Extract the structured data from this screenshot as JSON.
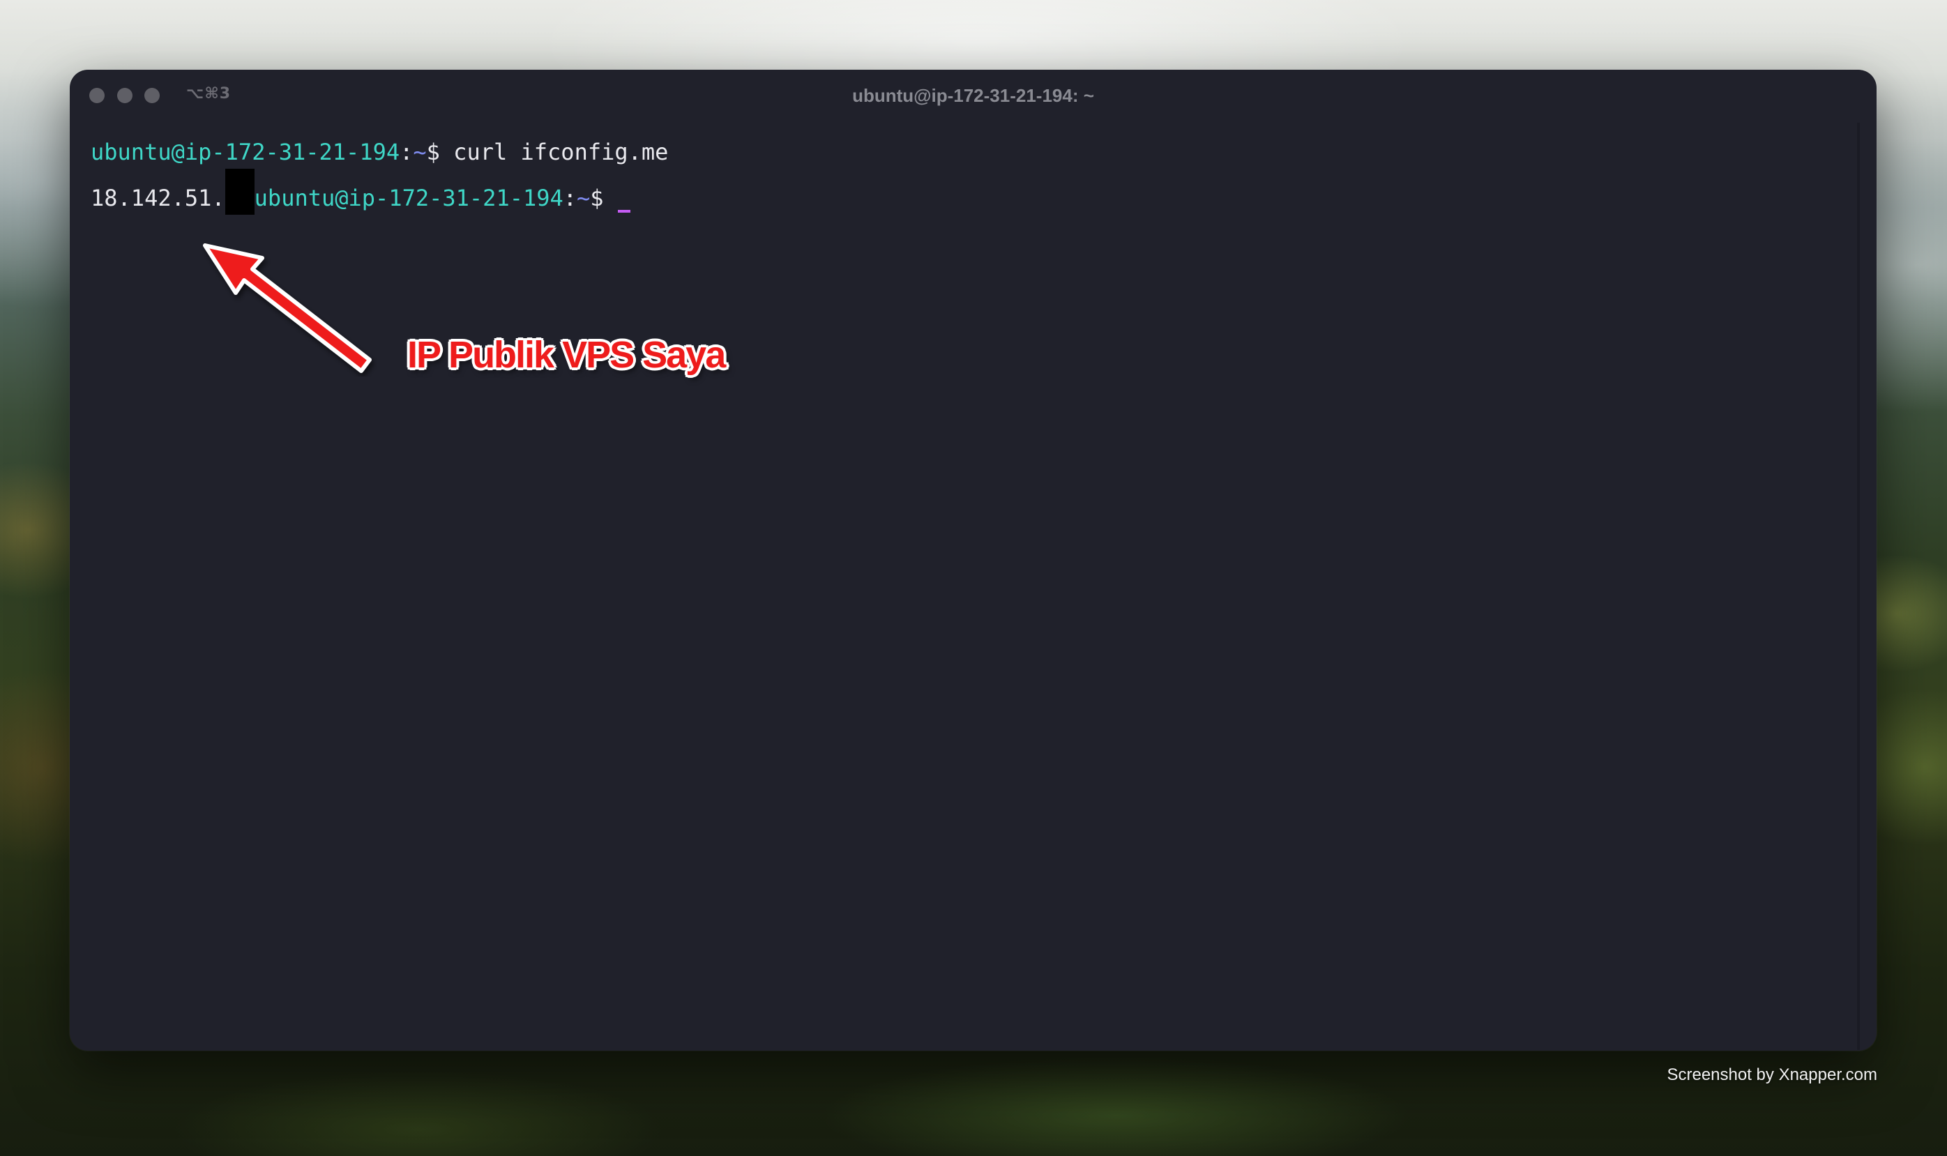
{
  "window": {
    "title": "ubuntu@ip-172-31-21-194: ~",
    "tab_shortcut": "⌥⌘3"
  },
  "terminal": {
    "lines": [
      {
        "user_host": "ubuntu@ip-172-31-21-194",
        "separator": ":",
        "path": "~",
        "dollar": "$",
        "command": " curl ifconfig.me"
      },
      {
        "output": "18.142.51.",
        "user_host": "ubuntu@ip-172-31-21-194",
        "separator": ":",
        "path": "~",
        "dollar": "$"
      }
    ],
    "colors": {
      "prompt_user": "#3fd7c7",
      "prompt_path": "#7f8cf0",
      "cursor": "#c45cf2",
      "background": "#20212b"
    }
  },
  "annotation": {
    "label": "IP Publik VPS Saya",
    "color": "#ee1c1c"
  },
  "watermark": {
    "text": "Screenshot by Xnapper.com"
  }
}
